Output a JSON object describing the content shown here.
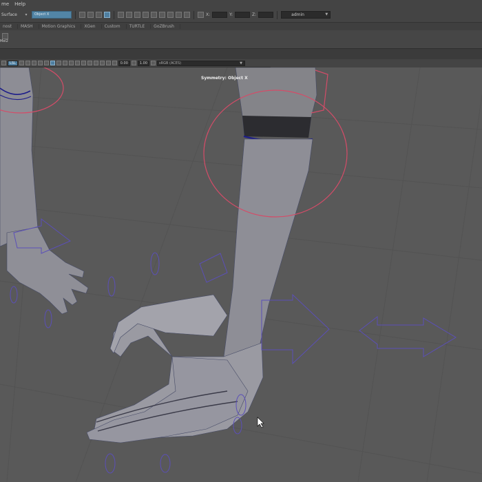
{
  "menubar": {
    "items": [
      "me",
      "Help"
    ]
  },
  "status": {
    "surface_label": "Surface",
    "object_field": "Object X",
    "x_label": "X:",
    "y_label": "Y:",
    "z_label": "Z:",
    "user": "admin"
  },
  "shelf_tabs": [
    "nost",
    "MASH",
    "Motion Graphics",
    "XGen",
    "Custom",
    "TURTLE",
    "GoZBrush"
  ],
  "shelf": {
    "item_label": "Mel2"
  },
  "panel_toolbar": {
    "sel_value": "LSL",
    "value_a": "0.00",
    "value_b": "1.00",
    "colorspace": "sRGB (ACES)"
  },
  "viewport": {
    "symmetry_label": "Symmetry: Object X",
    "colors": {
      "background": "#595959",
      "mesh_fill": "#8d8d95",
      "wire": "#454a66",
      "selection_edge": "#1d1d8a",
      "ik_circle": "#d44c68",
      "manipulator": "#5b4fb8"
    }
  }
}
